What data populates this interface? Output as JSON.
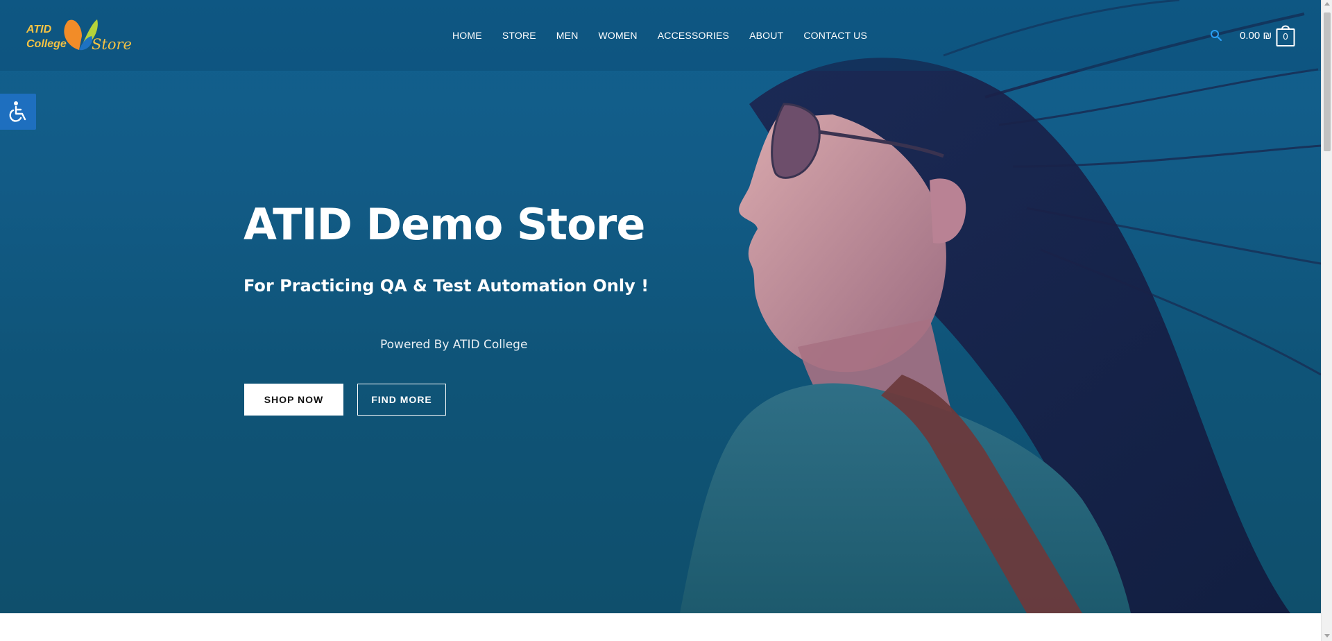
{
  "logo": {
    "line1": "ATID",
    "line2": "College",
    "line3": "Store"
  },
  "nav": {
    "items": [
      {
        "label": "HOME"
      },
      {
        "label": "STORE"
      },
      {
        "label": "MEN"
      },
      {
        "label": "WOMEN"
      },
      {
        "label": "ACCESSORIES"
      },
      {
        "label": "ABOUT"
      },
      {
        "label": "CONTACT US"
      }
    ]
  },
  "header": {
    "search_icon": "search-icon",
    "cart_total": "0.00 ₪",
    "cart_count": "0"
  },
  "accessibility": {
    "icon": "wheelchair-icon"
  },
  "hero": {
    "title": "ATID Demo Store",
    "subtitle": "For Practicing QA & Test Automation Only !",
    "powered": "Powered By ATID College",
    "shop_now": "SHOP NOW",
    "find_more": "FIND MORE"
  },
  "colors": {
    "hero_blue": "#125b86",
    "accent": "#1e6fbf",
    "logo_yellow": "#f6c343",
    "search_blue": "#2a9df4"
  }
}
